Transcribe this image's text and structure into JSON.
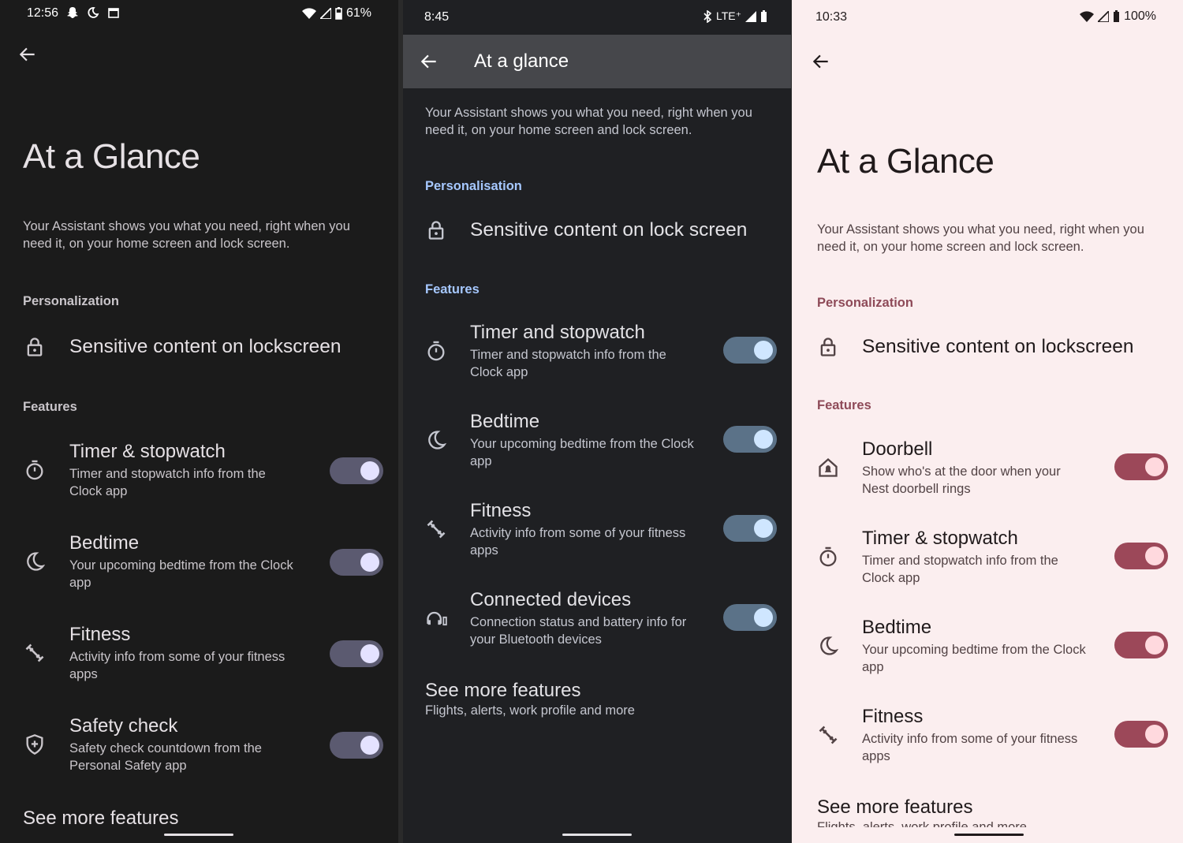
{
  "screens": [
    {
      "status": {
        "time": "12:56",
        "battery": "61%"
      },
      "title": "At a Glance",
      "description_lines": [
        "Your Assistant shows you what you need, right when you",
        "need it, on your home screen and lock screen."
      ],
      "personalization_heading": "Personalization",
      "sensitive_label": "Sensitive content on lockscreen",
      "features_heading": "Features",
      "items": [
        {
          "title": "Timer & stopwatch",
          "sub": [
            "Timer and stopwatch info from the",
            "Clock app"
          ],
          "icon": "timer-icon",
          "enabled": true
        },
        {
          "title": "Bedtime",
          "sub": [
            "Your upcoming bedtime from the Clock",
            "app"
          ],
          "icon": "moon-icon",
          "enabled": true
        },
        {
          "title": "Fitness",
          "sub": [
            "Activity info from some of your fitness",
            "apps"
          ],
          "icon": "fitness-icon",
          "enabled": true
        },
        {
          "title": "Safety check",
          "sub": [
            "Safety check countdown from the",
            "Personal Safety app"
          ],
          "icon": "shield-icon",
          "enabled": true
        }
      ],
      "see_more_title": "See more features"
    },
    {
      "status": {
        "time": "8:45",
        "network": "LTE⁺"
      },
      "title": "At a glance",
      "description_lines": [
        "Your Assistant shows you what you need, right when you",
        "need it, on your home screen and lock screen."
      ],
      "personalization_heading": "Personalisation",
      "sensitive_label": "Sensitive content on lock screen",
      "features_heading": "Features",
      "items": [
        {
          "title": "Timer and stopwatch",
          "sub": [
            "Timer and stopwatch info from the",
            "Clock app"
          ],
          "icon": "timer-icon",
          "enabled": true
        },
        {
          "title": "Bedtime",
          "sub": [
            "Your upcoming bedtime from the Clock",
            "app"
          ],
          "icon": "moon-icon",
          "enabled": true
        },
        {
          "title": "Fitness",
          "sub": [
            "Activity info from some of your fitness",
            "apps"
          ],
          "icon": "fitness-icon",
          "enabled": true
        },
        {
          "title": "Connected devices",
          "sub": [
            "Connection status and battery info for",
            "your Bluetooth devices"
          ],
          "icon": "headphones-icon",
          "enabled": true
        }
      ],
      "see_more_title": "See more features",
      "see_more_sub": "Flights, alerts, work profile and more"
    },
    {
      "status": {
        "time": "10:33",
        "battery": "100%"
      },
      "title": "At a Glance",
      "description_lines": [
        "Your Assistant shows you what you need, right when you",
        "need it, on your home screen and lock screen."
      ],
      "personalization_heading": "Personalization",
      "sensitive_label": "Sensitive content on lockscreen",
      "features_heading": "Features",
      "items": [
        {
          "title": "Doorbell",
          "sub": [
            "Show who's at the door when your",
            "Nest doorbell rings"
          ],
          "icon": "doorbell-icon",
          "enabled": true
        },
        {
          "title": "Timer & stopwatch",
          "sub": [
            "Timer and stopwatch info from the",
            "Clock app"
          ],
          "icon": "timer-icon",
          "enabled": true
        },
        {
          "title": "Bedtime",
          "sub": [
            "Your upcoming bedtime from the Clock",
            "app"
          ],
          "icon": "moon-icon",
          "enabled": true
        },
        {
          "title": "Fitness",
          "sub": [
            "Activity info from some of your fitness",
            "apps"
          ],
          "icon": "fitness-icon",
          "enabled": true
        }
      ],
      "see_more_title": "See more features",
      "see_more_sub": "Flights, alerts, work profile and more"
    }
  ],
  "colors": {
    "screen1_bg": "#1b1b1b",
    "screen2_bg": "#1f2023",
    "screen3_bg": "#fbeeef",
    "screen1_accent": "#5b5a70",
    "screen2_accent": "#5b7288",
    "screen3_accent": "#9c4859",
    "screen3_heading": "#8e4a58"
  }
}
